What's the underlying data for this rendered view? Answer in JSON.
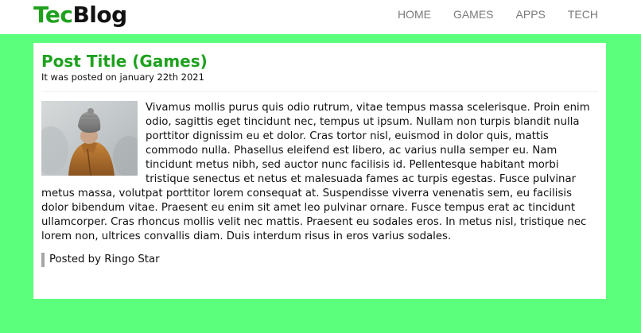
{
  "header": {
    "logo_part1": "Tec",
    "logo_part2": "Blog",
    "nav": [
      {
        "label": "HOME"
      },
      {
        "label": "GAMES"
      },
      {
        "label": "APPS"
      },
      {
        "label": "TECH"
      }
    ]
  },
  "post": {
    "title": "Post Title (Games)",
    "meta": "It was posted on january 22th 2021",
    "image": {
      "icon": "person-in-hat-photo"
    },
    "body": "Vivamus mollis purus quis odio rutrum, vitae tempus massa scelerisque. Proin enim odio, sagittis eget tincidunt nec, tempus ut ipsum. Nullam non turpis blandit nulla porttitor dignissim eu et dolor. Cras tortor nisl, euismod in dolor quis, mattis commodo nulla. Phasellus eleifend est libero, ac varius nulla semper eu. Nam tincidunt metus nibh, sed auctor nunc facilisis id. Pellentesque habitant morbi tristique senectus et netus et malesuada fames ac turpis egestas. Fusce pulvinar metus massa, volutpat porttitor lorem consequat at. Suspendisse viverra venenatis sem, eu facilisis dolor bibendum vitae. Praesent eu enim sit amet leo pulvinar ornare. Fusce tempus erat ac tincidunt ullamcorper. Cras rhoncus mollis velit nec mattis. Praesent eu sodales eros. In metus nisl, tristique nec lorem non, ultrices convallis diam. Duis interdum risus in eros varius sodales.",
    "footer": "Posted by Ringo Star"
  },
  "colors": {
    "background": "#5cff7c",
    "accent": "#1fa11f",
    "nav_text": "#7a7a7a",
    "footer_bar": "#a6a6a6"
  }
}
